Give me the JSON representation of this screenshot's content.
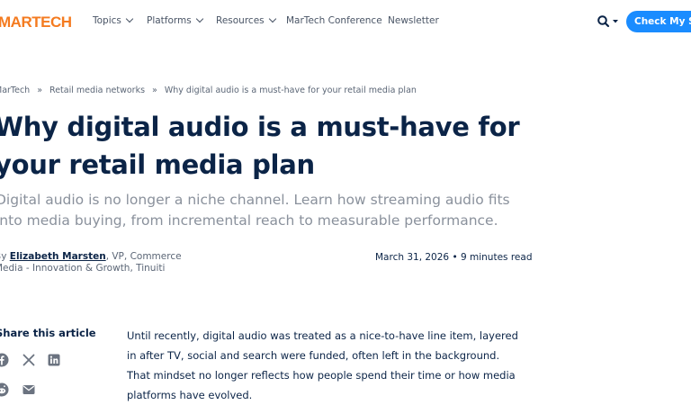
{
  "header": {
    "logo": "MARTECH",
    "nav": [
      {
        "label": "Topics",
        "dropdown": true
      },
      {
        "label": "Platforms",
        "dropdown": true
      },
      {
        "label": "Resources",
        "dropdown": true
      },
      {
        "label": "MarTech Conference",
        "dropdown": false
      },
      {
        "label": "Newsletter",
        "dropdown": false
      }
    ],
    "search_icon": "search-icon",
    "cta_label": "Check My SEO"
  },
  "breadcrumb": {
    "items": [
      "MarTech",
      "Retail media networks",
      "Why digital audio is a must-have for your retail media plan"
    ],
    "separator": "»"
  },
  "article": {
    "title": "Why digital audio is a must-have for your retail media plan",
    "dek": "Digital audio is no longer a niche channel. Learn how streaming audio fits into media buying, from incremental reach to measurable performance.",
    "byline_prefix": "By",
    "author": "Elizabeth Marsten",
    "author_role": ", VP, Commerce Media - Innovation & Growth, Tinuiti",
    "date": "March 31, 2026",
    "read_time": "9 minutes read",
    "body": "Until recently, digital audio was treated as a nice-to-have line item, layered in after TV, social and search were funded, often left in the background. That mindset no longer reflects how people spend their time or how media platforms have evolved."
  },
  "share": {
    "heading": "Share this article",
    "icons": [
      "facebook-icon",
      "x-icon",
      "linkedin-icon",
      "reddit-icon",
      "email-icon"
    ]
  },
  "colors": {
    "brand": "#f47b20",
    "cta": "#1a8cff",
    "heading": "#0b2447",
    "muted": "#8a919c"
  }
}
